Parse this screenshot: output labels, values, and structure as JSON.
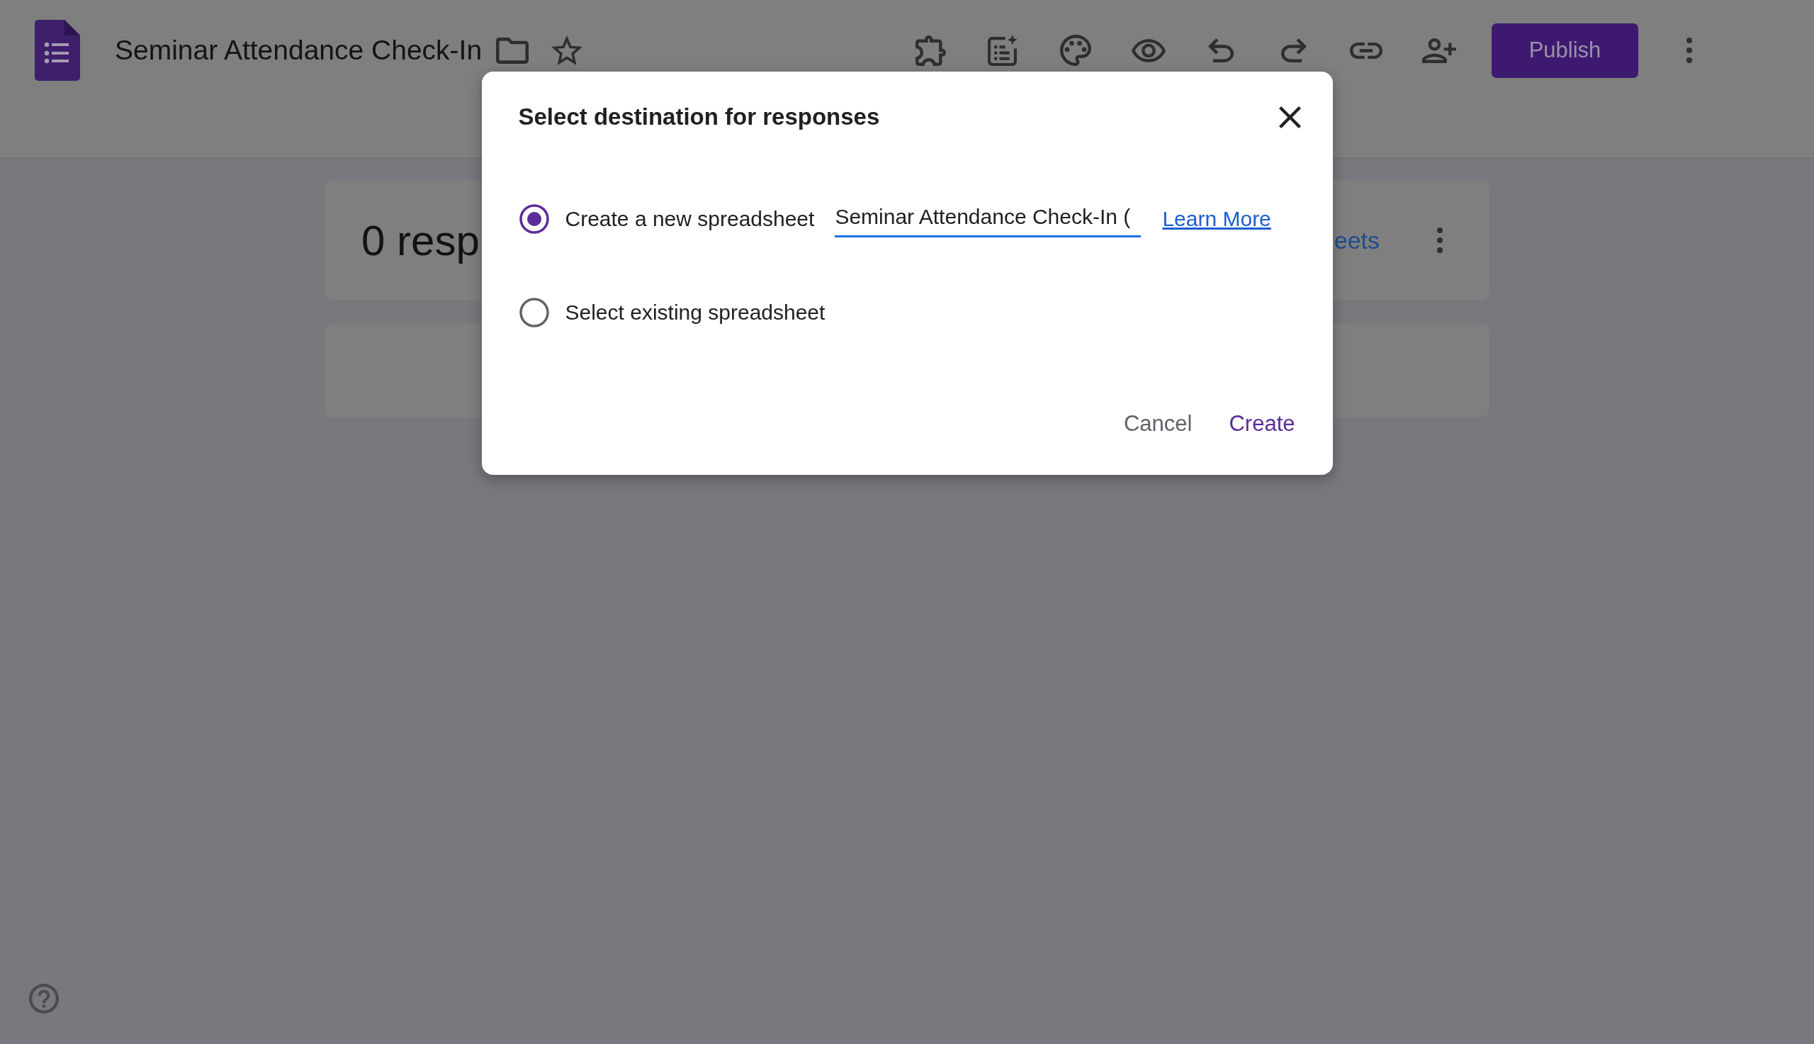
{
  "header": {
    "title": "Seminar Attendance Check-In",
    "publish_button": "Publish"
  },
  "responses_card": {
    "count_text": "0 resp",
    "link_text": "eets"
  },
  "dialog": {
    "title": "Select destination for responses",
    "options": [
      {
        "label": "Create a new spreadsheet",
        "selected": true,
        "field_value": "Seminar Attendance Check-In (",
        "link": "Learn More"
      },
      {
        "label": "Select existing spreadsheet",
        "selected": false
      }
    ],
    "buttons": [
      {
        "label": "Cancel",
        "kind": "secondary"
      },
      {
        "label": "Create",
        "kind": "primary"
      }
    ]
  }
}
